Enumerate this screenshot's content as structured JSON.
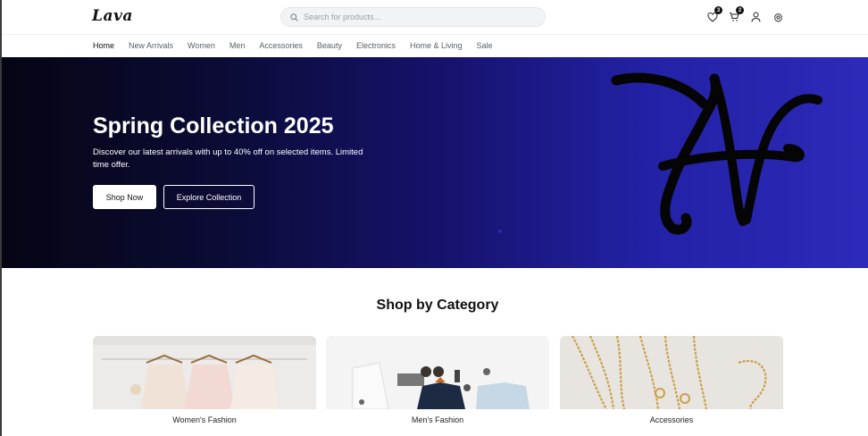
{
  "header": {
    "logo": "Lava",
    "search_placeholder": "Search for products...",
    "wishlist_count": "3",
    "cart_count": "2"
  },
  "nav": {
    "items": [
      "Home",
      "New Arrivals",
      "Women",
      "Men",
      "Accessories",
      "Beauty",
      "Electronics",
      "Home & Living",
      "Sale"
    ],
    "active": "Home"
  },
  "hero": {
    "title": "Spring Collection 2025",
    "subtitle": "Discover our latest arrivals with up to 40% off on selected items. Limited time offer.",
    "primary_button": "Shop Now",
    "secondary_button": "Explore Collection"
  },
  "categories": {
    "title": "Shop by Category",
    "items": [
      {
        "label": "Women's Fashion"
      },
      {
        "label": "Men's Fashion"
      },
      {
        "label": "Accessories"
      }
    ]
  },
  "colors": {
    "hero_start": "#050514",
    "hero_end": "#2c2ab8",
    "accent": "#111111"
  },
  "icons": [
    "search-icon",
    "heart-icon",
    "cart-icon",
    "user-icon",
    "gear-icon"
  ]
}
